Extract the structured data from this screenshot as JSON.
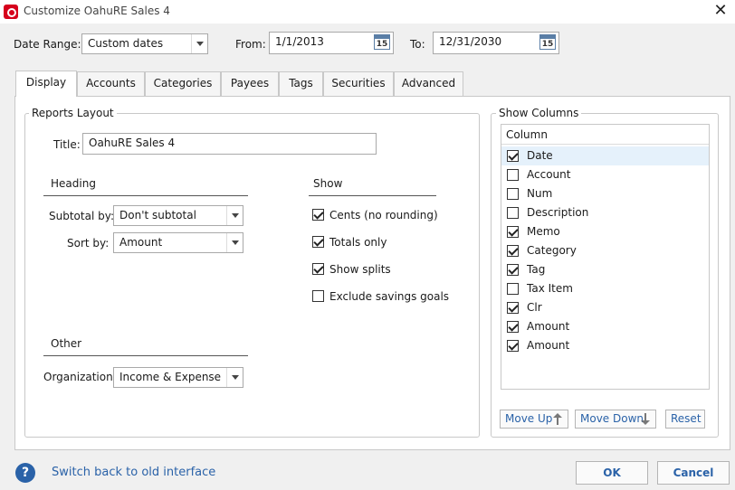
{
  "window": {
    "title": "Customize OahuRE Sales 4"
  },
  "date_range": {
    "label": "Date Range:",
    "value": "Custom dates",
    "from_label": "From:",
    "from_value": "1/1/2013",
    "to_label": "To:",
    "to_value": "12/31/2030",
    "calendar_day": "15"
  },
  "tabs": [
    {
      "label": "Display"
    },
    {
      "label": "Accounts"
    },
    {
      "label": "Categories"
    },
    {
      "label": "Payees"
    },
    {
      "label": "Tags"
    },
    {
      "label": "Securities"
    },
    {
      "label": "Advanced"
    }
  ],
  "reports_layout": {
    "group_label": "Reports Layout",
    "title_label": "Title:",
    "title_value": "OahuRE Sales 4",
    "heading": {
      "label": "Heading",
      "subtotal_label": "Subtotal by:",
      "subtotal_value": "Don't subtotal",
      "sort_label": "Sort by:",
      "sort_value": "Amount"
    },
    "show": {
      "label": "Show",
      "options": [
        {
          "label": "Cents (no rounding)",
          "checked": true
        },
        {
          "label": "Totals only",
          "checked": true
        },
        {
          "label": "Show splits",
          "checked": true
        },
        {
          "label": "Exclude savings goals",
          "checked": false
        }
      ]
    },
    "other": {
      "label": "Other",
      "organization_label": "Organization:",
      "organization_value": "Income & Expense"
    }
  },
  "show_columns": {
    "group_label": "Show Columns",
    "header": "Column",
    "columns": [
      {
        "label": "Date",
        "checked": true,
        "selected": true
      },
      {
        "label": "Account",
        "checked": false
      },
      {
        "label": "Num",
        "checked": false
      },
      {
        "label": "Description",
        "checked": false
      },
      {
        "label": "Memo",
        "checked": true
      },
      {
        "label": "Category",
        "checked": true
      },
      {
        "label": "Tag",
        "checked": true
      },
      {
        "label": "Tax Item",
        "checked": false
      },
      {
        "label": "Clr",
        "checked": true
      },
      {
        "label": "Amount",
        "checked": true
      },
      {
        "label": "Amount",
        "checked": true
      }
    ],
    "move_up_label": "Move Up",
    "move_down_label": "Move Down",
    "reset_label": "Reset"
  },
  "footer": {
    "help_glyph": "?",
    "switch_link": "Switch back to old interface",
    "ok_label": "OK",
    "cancel_label": "Cancel"
  },
  "colors": {
    "accent": "#2a62a8",
    "brand": "#d6001c",
    "selection": "#e5f1fb"
  }
}
